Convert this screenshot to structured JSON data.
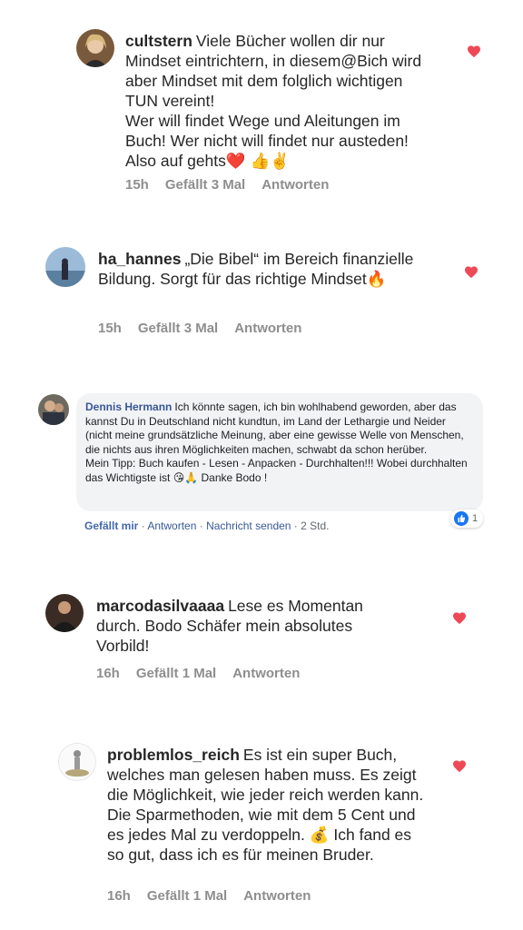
{
  "comments": [
    {
      "username": "cultstern",
      "lines": [
        "Viele Bücher wollen dir nur Mindset eintrichtern, in diesem@Bich wird aber Mindset mit dem folglich wichtigen TUN vereint!",
        "Wer will findet Wege und Aleitungen im Buch! Wer nicht will findet nur austeden!",
        "Also auf gehts❤️ 👍✌️"
      ],
      "time": "15h",
      "likes": "Gefällt 3 Mal",
      "reply": "Antworten"
    },
    {
      "username": "ha_hannes",
      "lines": [
        "„Die Bibel“ im Bereich finanzielle Bildung. Sorgt für das richtige Mindset🔥"
      ],
      "time": "15h",
      "likes": "Gefällt 3 Mal",
      "reply": "Antworten"
    },
    {
      "username": "marcodasilvaaaa",
      "lines": [
        "Lese es Momentan durch. Bodo Schäfer mein absolutes Vorbild!"
      ],
      "time": "16h",
      "likes": "Gefällt 1 Mal",
      "reply": "Antworten"
    },
    {
      "username": "problemlos_reich",
      "lines": [
        "Es ist ein super Buch, welches man gelesen haben muss. Es zeigt die Möglichkeit, wie jeder reich werden kann. Die Sparmethoden, wie mit dem 5 Cent und es jedes Mal zu verdoppeln. 💰 Ich fand es so gut, dass ich es für meinen Bruder."
      ],
      "time": "16h",
      "likes": "Gefällt 1 Mal",
      "reply": "Antworten"
    }
  ],
  "fb_comment": {
    "name": "Dennis Hermann",
    "text": "Ich könnte sagen, ich bin wohlhabend geworden, aber das kannst Du in Deutschland nicht kundtun, im Land der Lethargie und Neider (nicht meine grundsätzliche Meinung, aber eine gewisse Welle von Menschen, die nichts aus ihren Möglichkeiten machen, schwabt da schon herüber.",
    "tip": "Mein Tipp: Buch kaufen - Lesen - Anpacken - Durchhalten!!! Wobei durchhalten das Wichtigste ist 😘🙏 Danke Bodo !",
    "like": "Gefällt mir",
    "sep1": " · ",
    "reply": "Antworten",
    "sep2": " · ",
    "message": "Nachricht senden",
    "sep3": " · ",
    "time": "2 Std.",
    "reaction_count": "1"
  },
  "colors": {
    "heart": "#ed4956",
    "meta": "#8e8e8e",
    "fb_link": "#385898",
    "fb_like": "#4267b2"
  },
  "icons": [
    "heart-icon",
    "like-reaction-icon"
  ]
}
